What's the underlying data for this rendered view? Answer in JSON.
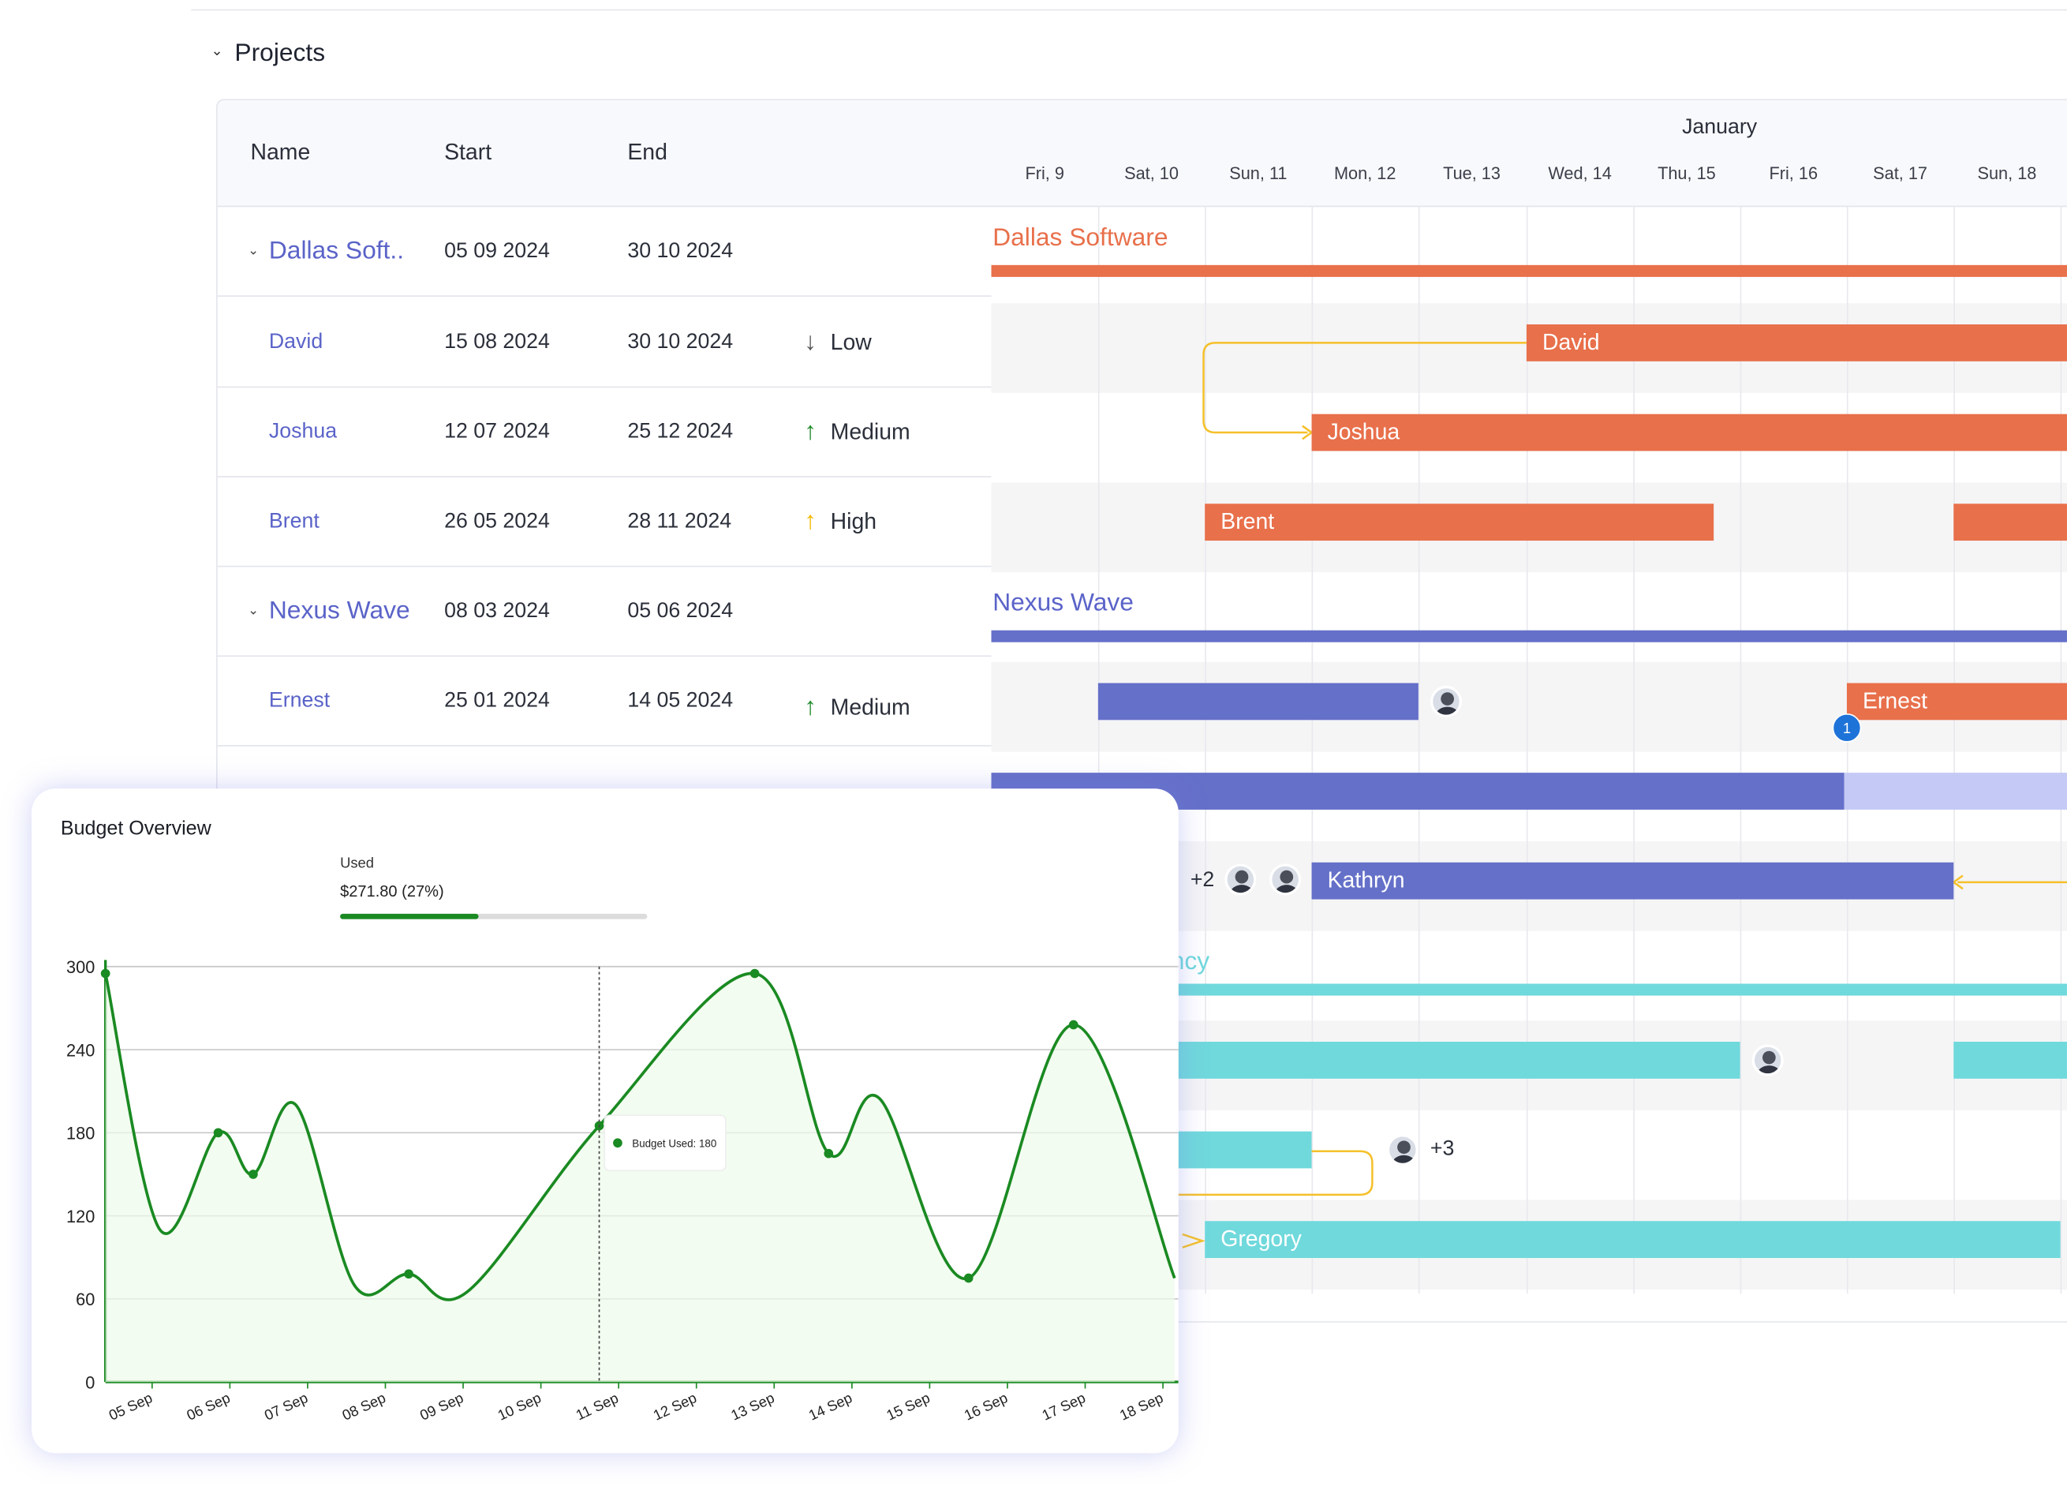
{
  "header": {
    "section_title": "Projects"
  },
  "columns": {
    "name": "Name",
    "start": "Start",
    "end": "End"
  },
  "timeline": {
    "month": "January",
    "days": [
      "Fri, 9",
      "Sat, 10",
      "Sun, 11",
      "Mon, 12",
      "Tue, 13",
      "Wed, 14",
      "Thu, 15",
      "Fri, 16",
      "Sat, 17",
      "Sun, 18"
    ]
  },
  "rows": [
    {
      "kind": "group",
      "name": "Dallas Soft..",
      "start": "05 09 2024",
      "end": "30 10 2024"
    },
    {
      "kind": "member",
      "name": "David",
      "start": "15 08 2024",
      "end": "30 10 2024",
      "priority": "Low",
      "arrow": "↓",
      "arrow_color": "#555555"
    },
    {
      "kind": "member",
      "name": "Joshua",
      "start": "12 07 2024",
      "end": "25 12 2024",
      "priority": "Medium",
      "arrow": "↑",
      "arrow_color": "#1f8a2a"
    },
    {
      "kind": "member",
      "name": "Brent",
      "start": "26 05 2024",
      "end": "28 11 2024",
      "priority": "High",
      "arrow": "↑",
      "arrow_color": "#f5b800"
    },
    {
      "kind": "group",
      "name": "Nexus Wave",
      "start": "08 03 2024",
      "end": "05 06 2024"
    },
    {
      "kind": "member",
      "name": "Ernest",
      "start": "25 01 2024",
      "end": "14 05 2024",
      "priority": "Medium",
      "arrow": "↑",
      "arrow_color": "#1f8a2a"
    }
  ],
  "gantt": {
    "group_labels": {
      "dallas": "Dallas Software",
      "nexus": "Nexus Wave",
      "partial": "ncy"
    },
    "bar_labels": {
      "david": "David",
      "joshua": "Joshua",
      "brent": "Brent",
      "ernest": "Ernest",
      "kathryn": "Kathryn",
      "gregory": "Gregory"
    },
    "extra_counts": {
      "kathryn": "+2",
      "teal": "+3"
    },
    "milestone": "1",
    "colors": {
      "orange": "#e8704b",
      "indigo": "#6570c9",
      "light_indigo": "#c4c9f5",
      "teal": "#70d9dc",
      "connector": "#f5c02a"
    }
  },
  "budget": {
    "title": "Budget Overview",
    "used_label": "Used",
    "used_value": "$271.80 (27%)",
    "used_fraction": 0.27,
    "accent": "#1a8a22"
  },
  "chart_data": {
    "type": "line",
    "title": "",
    "xlabel": "",
    "ylabel": "",
    "categories": [
      "05 Sep",
      "06 Sep",
      "07 Sep",
      "08 Sep",
      "09 Sep",
      "10 Sep",
      "11 Sep",
      "12 Sep",
      "13 Sep",
      "14 Sep",
      "15 Sep",
      "16 Sep",
      "17 Sep",
      "18 Sep"
    ],
    "yticks": [
      0,
      60,
      120,
      180,
      240,
      300
    ],
    "ylim": [
      0,
      300
    ],
    "points": [
      {
        "x": 0.0,
        "y": 295
      },
      {
        "x": 0.7,
        "y": 110
      },
      {
        "x": 1.45,
        "y": 180
      },
      {
        "x": 1.9,
        "y": 150
      },
      {
        "x": 2.45,
        "y": 200
      },
      {
        "x": 3.2,
        "y": 70
      },
      {
        "x": 3.9,
        "y": 78
      },
      {
        "x": 4.65,
        "y": 65
      },
      {
        "x": 6.35,
        "y": 185
      },
      {
        "x": 8.35,
        "y": 295
      },
      {
        "x": 9.3,
        "y": 165
      },
      {
        "x": 9.95,
        "y": 205
      },
      {
        "x": 11.1,
        "y": 75
      },
      {
        "x": 12.45,
        "y": 258
      },
      {
        "x": 13.75,
        "y": 75
      }
    ],
    "markers": [
      0,
      2,
      3,
      6,
      8,
      9,
      10,
      12,
      13
    ],
    "tooltip": {
      "at_index": 8,
      "text": "Budget Used: 180"
    },
    "legend": "none",
    "grid": true
  }
}
